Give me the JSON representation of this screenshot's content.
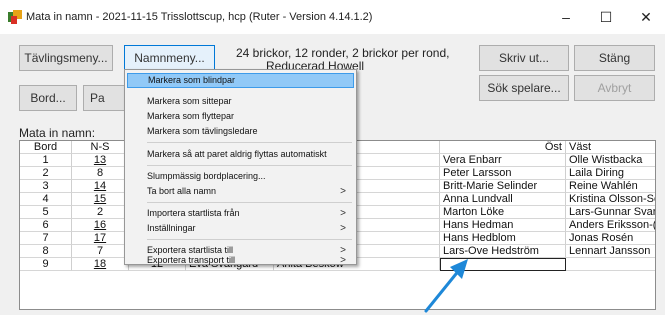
{
  "window": {
    "title": "Mata in namn - 2021-11-15  Trisslottscup, hcp  (Ruter - Version 4.14.1.2)",
    "min_glyph": "–",
    "max_glyph": "☐",
    "close_glyph": "✕"
  },
  "toolbar": {
    "tavlingsmeny": "Tävlingsmeny...",
    "namnmeny": "Namnmeny...",
    "bord": "Bord...",
    "pa_partial": "Pa",
    "skriv_ut": "Skriv ut...",
    "stang": "Stäng",
    "sok_spelare": "Sök spelare...",
    "avbryt": "Avbryt"
  },
  "info": {
    "line1": "24 brickor, 12 ronder, 2 brickor per rond,",
    "line2": "Reducerad Howell"
  },
  "grid_label": "Mata in namn:",
  "grid": {
    "headers": {
      "bord": "Bord",
      "ns": "N-S",
      "ost": "Öst",
      "vast": "Väst"
    },
    "rows": [
      {
        "bord": "1",
        "ns": "13",
        "ow": "",
        "n1": "",
        "n2": "damsson",
        "ost": "Vera Enbarr",
        "vast": "Olle Wistbacka"
      },
      {
        "bord": "2",
        "ns": "8",
        "ow": "",
        "n1": "",
        "n2": "Ek",
        "ost": "Peter Larsson",
        "vast": "Laila Diring"
      },
      {
        "bord": "3",
        "ns": "14",
        "ow": "",
        "n1": "",
        "n2": "agerlund",
        "ost": "Britt-Marie Selinder",
        "vast": "Reine Wahlén"
      },
      {
        "bord": "4",
        "ns": "15",
        "ow": "",
        "n1": "",
        "n2": "ödercrantz",
        "ost": "Anna Lundvall",
        "vast": "Kristina Olsson-Sc"
      },
      {
        "bord": "5",
        "ns": "2",
        "ow": "",
        "n1": "",
        "n2": "Mattsson",
        "ost": "Marton Löke",
        "vast": "Lars-Gunnar Svar"
      },
      {
        "bord": "6",
        "ns": "16",
        "ow": "",
        "n1": "",
        "n2": "Dotzauer",
        "ost": "Hans Hedman",
        "vast": "Anders Eriksson-("
      },
      {
        "bord": "7",
        "ns": "17",
        "ow": "",
        "n1": "",
        "n2": "ndqvist",
        "ost": "Hans Hedblom",
        "vast": "Jonas Rosén"
      },
      {
        "bord": "8",
        "ns": "7",
        "ow": "",
        "n1": "",
        "n2": "dman",
        "ost": "Lars-Ove Hedström",
        "vast": "Lennart Jansson"
      },
      {
        "bord": "9",
        "ns": "18",
        "ow": "12",
        "n1": "Eva Svangård",
        "n2": "Anita Beskow",
        "ost": "",
        "vast": ""
      }
    ]
  },
  "menu": {
    "items": [
      {
        "label": "Markera som blindpar",
        "highlighted": true,
        "submenu": false
      },
      {
        "label": "Markera som sittepar",
        "submenu": false
      },
      {
        "label": "Markera som flyttepar",
        "submenu": false
      },
      {
        "label": "Markera som tävlingsledare",
        "submenu": false
      },
      {
        "label": "Markera så att paret aldrig flyttas automatiskt",
        "submenu": false
      },
      {
        "label": "Slumpmässig bordplacering...",
        "submenu": false
      },
      {
        "label": "Ta bort alla namn",
        "submenu": true
      },
      {
        "label": "Importera startlista från",
        "submenu": true
      },
      {
        "label": "Inställningar",
        "submenu": true
      },
      {
        "label": "Exportera startlista till",
        "submenu": true
      },
      {
        "label": "Exportera transport till",
        "submenu": true
      }
    ],
    "arrow_glyph": ">"
  },
  "colors": {
    "menu_highlight": "#91c9f7",
    "annotation_arrow": "#1e88d8"
  }
}
